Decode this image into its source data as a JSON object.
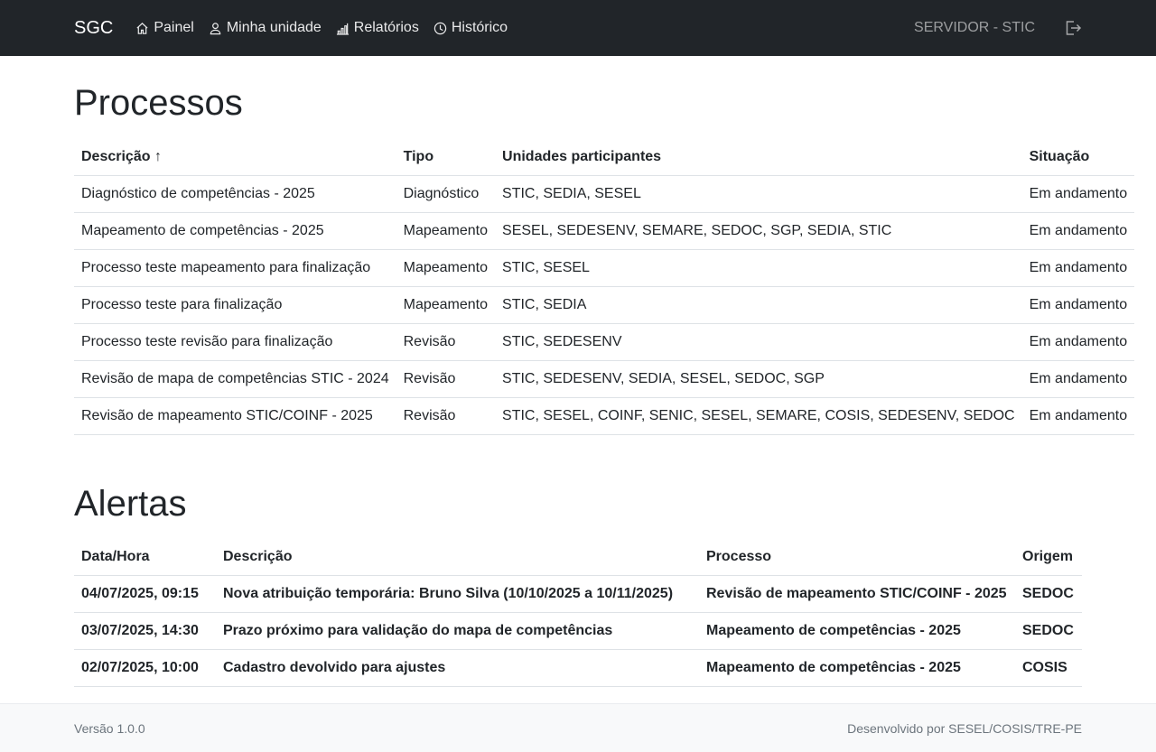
{
  "navbar": {
    "brand": "SGC",
    "links": [
      {
        "label": "Painel",
        "icon": "house-icon"
      },
      {
        "label": "Minha unidade",
        "icon": "person-icon"
      },
      {
        "label": "Relatórios",
        "icon": "bar-chart-icon"
      },
      {
        "label": "Histórico",
        "icon": "clock-icon"
      }
    ],
    "user": "SERVIDOR - STIC",
    "logout_icon": "logout-icon"
  },
  "processes": {
    "title": "Processos",
    "headers": {
      "descricao": "Descrição ↑",
      "tipo": "Tipo",
      "unidades": "Unidades participantes",
      "situacao": "Situação"
    },
    "rows": [
      {
        "descricao": "Diagnóstico de competências - 2025",
        "tipo": "Diagnóstico",
        "unidades": "STIC, SEDIA, SESEL",
        "situacao": "Em andamento"
      },
      {
        "descricao": "Mapeamento de competências - 2025",
        "tipo": "Mapeamento",
        "unidades": "SESEL, SEDESENV, SEMARE, SEDOC, SGP, SEDIA, STIC",
        "situacao": "Em andamento"
      },
      {
        "descricao": "Processo teste mapeamento para finalização",
        "tipo": "Mapeamento",
        "unidades": "STIC, SESEL",
        "situacao": "Em andamento"
      },
      {
        "descricao": "Processo teste para finalização",
        "tipo": "Mapeamento",
        "unidades": "STIC, SEDIA",
        "situacao": "Em andamento"
      },
      {
        "descricao": "Processo teste revisão para finalização",
        "tipo": "Revisão",
        "unidades": "STIC, SEDESENV",
        "situacao": "Em andamento"
      },
      {
        "descricao": "Revisão de mapa de competências STIC - 2024",
        "tipo": "Revisão",
        "unidades": "STIC, SEDESENV, SEDIA, SESEL, SEDOC, SGP",
        "situacao": "Em andamento"
      },
      {
        "descricao": "Revisão de mapeamento STIC/COINF - 2025",
        "tipo": "Revisão",
        "unidades": "STIC, SESEL, COINF, SENIC, SESEL, SEMARE, COSIS, SEDESENV, SEDOC",
        "situacao": "Em andamento"
      }
    ]
  },
  "alerts": {
    "title": "Alertas",
    "headers": {
      "data": "Data/Hora",
      "descricao": "Descrição",
      "processo": "Processo",
      "origem": "Origem"
    },
    "rows": [
      {
        "data": "04/07/2025, 09:15",
        "descricao": "Nova atribuição temporária: Bruno Silva (10/10/2025 a 10/11/2025)",
        "processo": "Revisão de mapeamento STIC/COINF - 2025",
        "origem": "SEDOC"
      },
      {
        "data": "03/07/2025, 14:30",
        "descricao": "Prazo próximo para validação do mapa de competências",
        "processo": "Mapeamento de competências - 2025",
        "origem": "SEDOC"
      },
      {
        "data": "02/07/2025, 10:00",
        "descricao": "Cadastro devolvido para ajustes",
        "processo": "Mapeamento de competências - 2025",
        "origem": "COSIS"
      }
    ]
  },
  "footer": {
    "version": "Versão 1.0.0",
    "credits": "Desenvolvido por SESEL/COSIS/TRE-PE"
  }
}
